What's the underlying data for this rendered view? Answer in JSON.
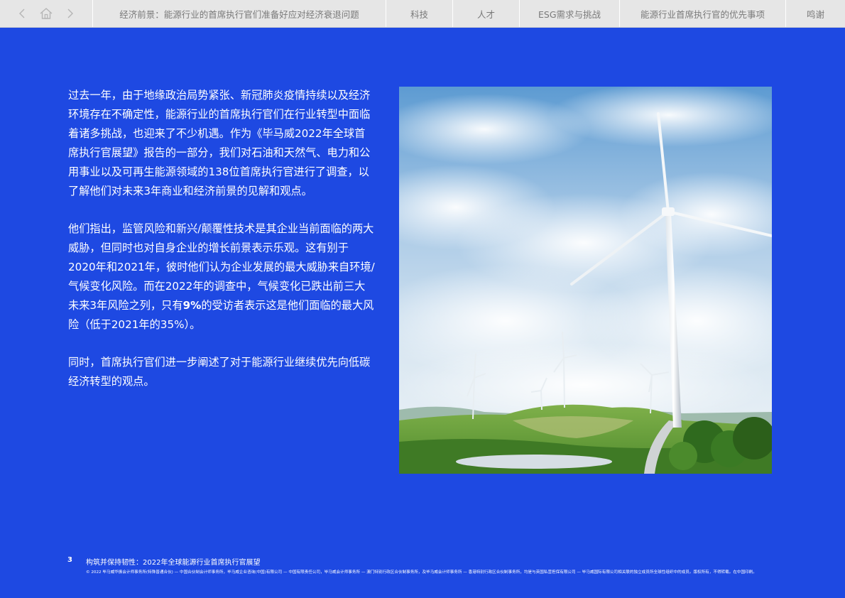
{
  "nav": {
    "tabs": [
      "经济前景：能源行业的首席执行官们准备好应对经济衰退问题",
      "科技",
      "人才",
      "ESG需求与挑战",
      "能源行业首席执行官的优先事项",
      "鸣谢"
    ]
  },
  "body": {
    "para1": "过去一年，由于地缘政治局势紧张、新冠肺炎疫情持续以及经济环境存在不确定性，能源行业的首席执行官们在行业转型中面临着诸多挑战，也迎来了不少机遇。作为《毕马威2022年全球首席执行官展望》报告的一部分，我们对石油和天然气、电力和公用事业以及可再生能源领域的138位首席执行官进行了调查，以了解他们对未来3年商业和经济前景的见解和观点。",
    "para2_a": "他们指出，监管风险和新兴/颠覆性技术是其企业当前面临的两大威胁，但同时也对自身企业的增长前景表示乐观。这有别于2020年和2021年，彼时他们认为企业发展的最大威胁来自环境/气候变化风险。而在2022年的调查中，气候变化已跌出前三大未来3年风险之列，只有",
    "para2_bold": "9%",
    "para2_b": "的受访者表示这是他们面临的最大风险（低于2021年的35%）。",
    "para3": "同时，首席执行官们进一步阐述了对于能源行业继续优先向低碳经济转型的观点。"
  },
  "footer": {
    "page_number": "3",
    "title": "构筑并保持韧性：2022年全球能源行业首席执行官展望",
    "legal": "© 2022 毕马威华振会计师事务所(特殊普通合伙) — 中国合伙制会计师事务所，毕马威企业咨询(中国)有限公司 — 中国有限责任公司，毕马威会计师事务所 — 澳门特别行政区合伙制事务所，及毕马威会计师事务所 — 香港特别行政区合伙制事务所，均是与英国私营担保有限公司 — 毕马威国际有限公司相关联的独立成员所全球性组织中的成员。版权所有，不得转载。在中国印刷。"
  },
  "colors": {
    "background": "#1e49e2",
    "nav_bg": "#e6e6e6",
    "nav_text": "#7a7a7a"
  },
  "icons": [
    "back-arrow-icon",
    "home-icon",
    "forward-arrow-icon"
  ]
}
